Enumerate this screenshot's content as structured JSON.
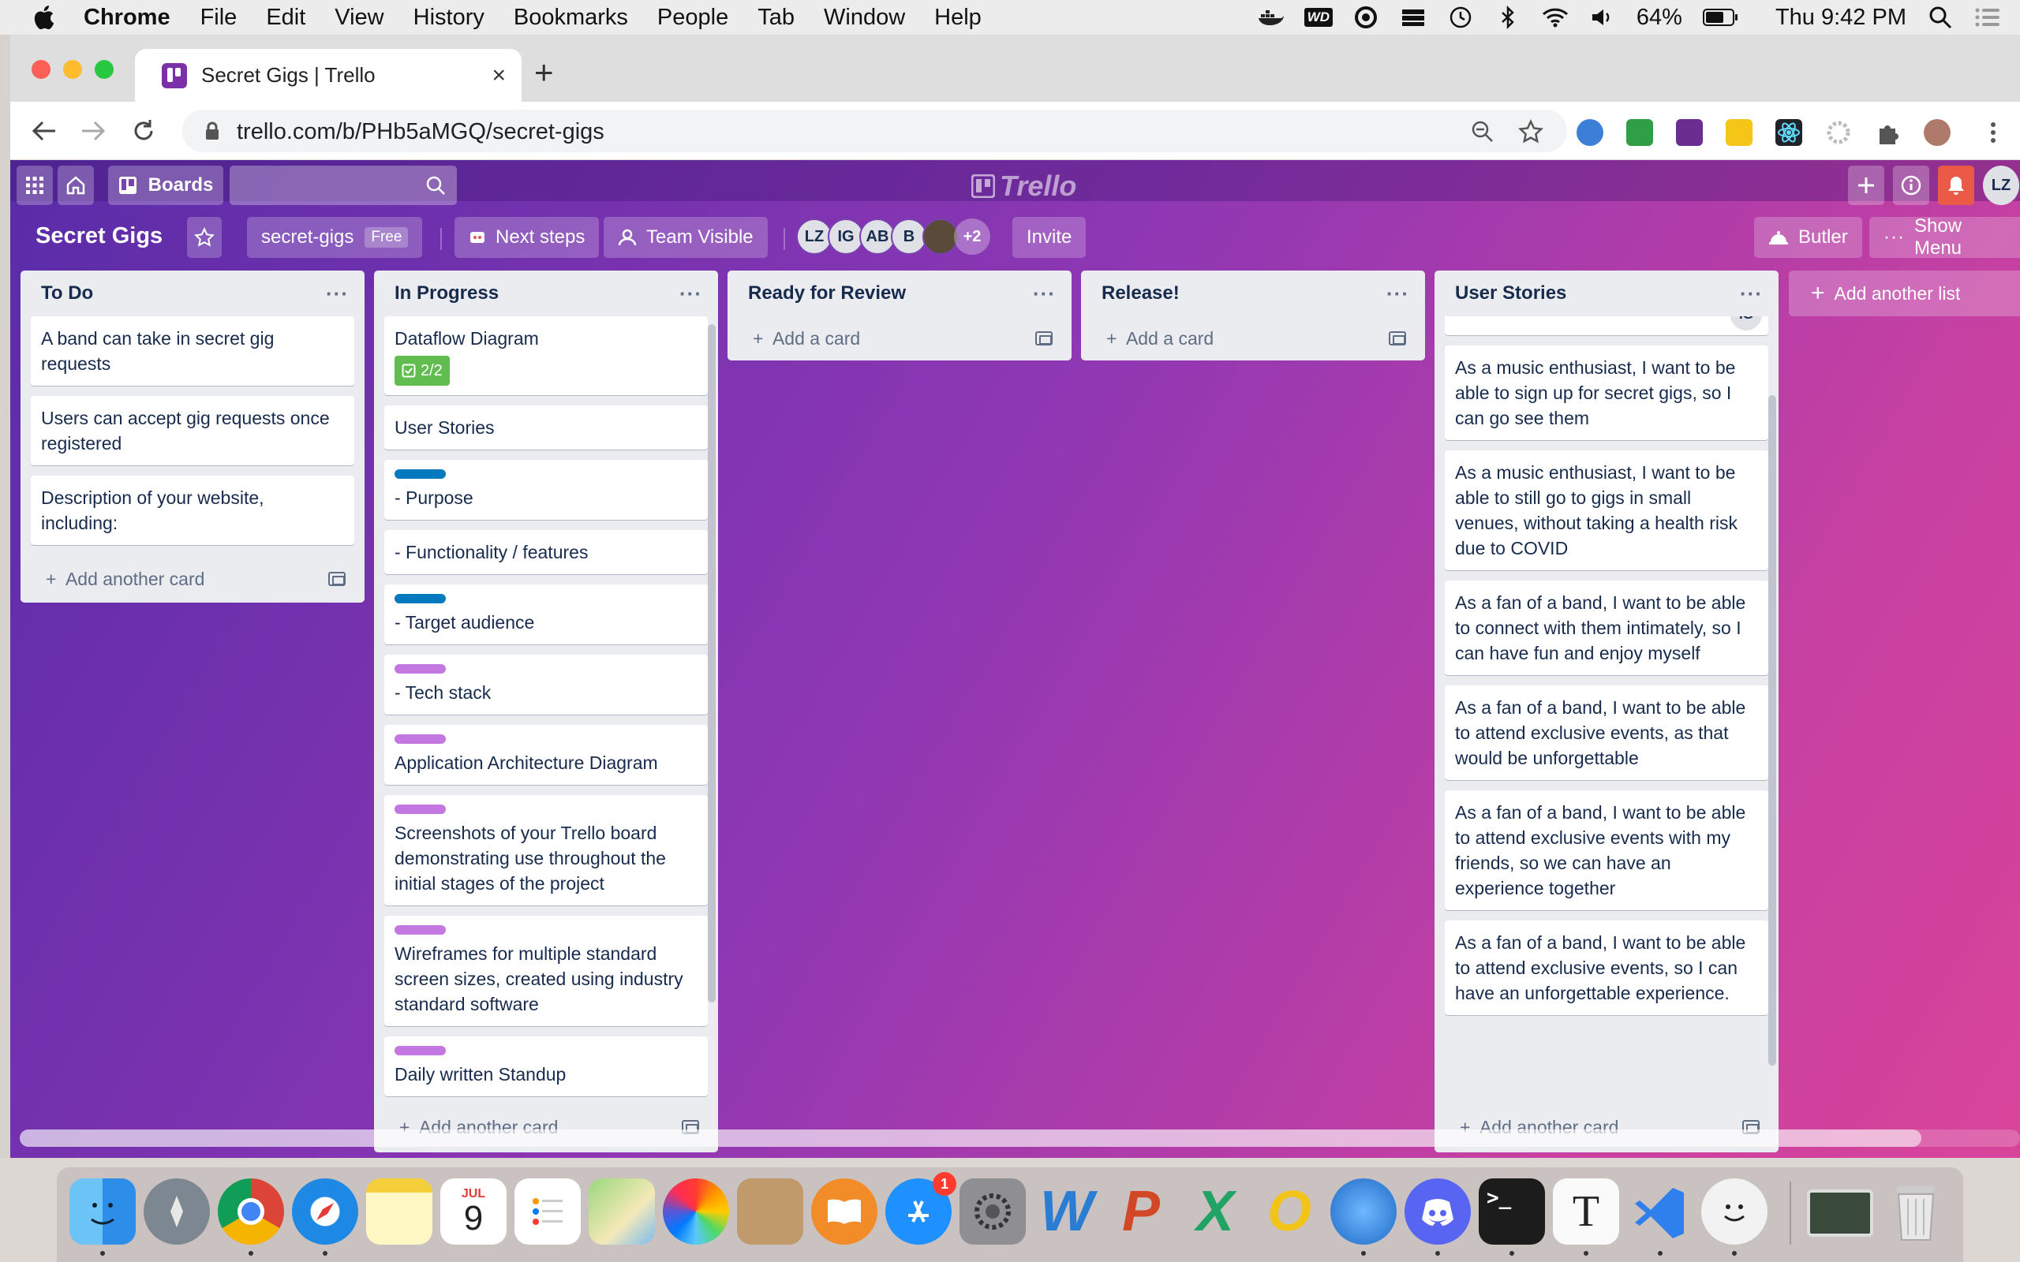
{
  "menubar": {
    "app_name": "Chrome",
    "items": [
      "File",
      "Edit",
      "View",
      "History",
      "Bookmarks",
      "People",
      "Tab",
      "Window",
      "Help"
    ],
    "battery": "64%",
    "clock": "Thu 9:42 PM",
    "wd_label": "WD"
  },
  "browser": {
    "tab_title": "Secret Gigs | Trello",
    "new_tab": "+",
    "close_tab": "×",
    "url": "trello.com/b/PHb5aMGQ/secret-gigs"
  },
  "trello_header": {
    "boards_label": "Boards",
    "logo_text": "Trello",
    "user_initials": "LZ"
  },
  "board": {
    "title": "Secret Gigs",
    "team_name": "secret-gigs",
    "plan_badge": "Free",
    "next_steps": "Next steps",
    "visibility": "Team Visible",
    "members": [
      "LZ",
      "IG",
      "AB",
      "B"
    ],
    "more_members": "+2",
    "invite": "Invite",
    "butler": "Butler",
    "show_menu": "Show Menu",
    "add_list": "Add another list"
  },
  "lists": [
    {
      "title": "To Do",
      "cards": [
        "A band can take in secret gig requests",
        "Users can accept gig requests once registered",
        "Description of your website, including:"
      ],
      "add_label": "Add another card"
    },
    {
      "title": "In Progress",
      "cards": [
        "Dataflow Diagram",
        "User Stories",
        "- Purpose",
        "- Functionality / features",
        "- Target audience",
        "- Tech stack",
        "Application Architecture Diagram",
        "Screenshots of your Trello board demonstrating use throughout the initial stages of the project",
        "Wireframes for multiple standard screen sizes, created using industry standard software",
        "Daily written Standup"
      ],
      "checklist_badge": "2/2",
      "add_label": "Add another card"
    },
    {
      "title": "Ready for Review",
      "add_label": "Add a card"
    },
    {
      "title": "Release!",
      "add_label": "Add a card"
    },
    {
      "title": "User Stories",
      "member_initials": "IG",
      "cards": [
        "As a music enthusiast, I want to be able to sign up for secret gigs, so I can go see them",
        "As a music enthusiast, I want to be able to still go to gigs in small venues, without taking a health risk due to COVID",
        "As a fan of a band, I want to be able to connect with them intimately, so I can have fun and enjoy myself",
        "As a fan of a band, I want to be able to attend exclusive events, as that would be unforgettable",
        "As a fan of a band, I want to be able to attend exclusive events with my friends, so we can have an experience together",
        "As a fan of a band, I want to be able to attend exclusive events, so I can have an unforgettable experience."
      ],
      "add_label": "Add another card"
    }
  ],
  "dock": {
    "calendar_month": "JUL",
    "calendar_day": "9",
    "appstore_badge": "1"
  },
  "colors": {
    "label_blue": "#0079bf",
    "label_purple": "#c377e0",
    "badge_green": "#61bd4f"
  }
}
